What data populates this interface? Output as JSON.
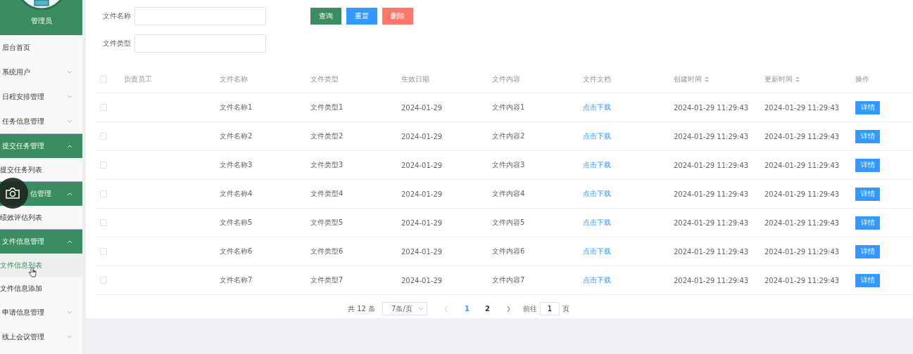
{
  "sidebar": {
    "user": "管理员",
    "items": [
      {
        "kind": "item",
        "label": "后台首页"
      },
      {
        "kind": "group",
        "label": "系统用户",
        "expanded": false
      },
      {
        "kind": "group",
        "label": "日程安排管理",
        "expanded": false
      },
      {
        "kind": "group",
        "label": "任务信息管理",
        "expanded": false
      },
      {
        "kind": "group",
        "label": "提交任务管理",
        "expanded": true,
        "children": [
          {
            "label": "提交任务列表",
            "selected": false
          }
        ]
      },
      {
        "kind": "group",
        "label": "估管理",
        "expanded": true,
        "covered": true,
        "children": [
          {
            "label": "绩效评估列表",
            "selected": false
          }
        ]
      },
      {
        "kind": "group",
        "label": "文件信息管理",
        "expanded": true,
        "children": [
          {
            "label": "文件信息列表",
            "selected": true
          },
          {
            "label": "文件信息添加",
            "selected": false
          }
        ]
      },
      {
        "kind": "group",
        "label": "申请信息管理",
        "expanded": false
      },
      {
        "kind": "group",
        "label": "线上会议管理",
        "expanded": false
      }
    ]
  },
  "search": {
    "fields": [
      {
        "label": "文件名称"
      },
      {
        "label": "文件类型"
      }
    ],
    "buttons": [
      {
        "label": "查询",
        "kind": "query"
      },
      {
        "label": "重置",
        "kind": "reset"
      },
      {
        "label": "删除",
        "kind": "delete"
      }
    ]
  },
  "table": {
    "all_checked": false,
    "columns": [
      {
        "label": "负责员工",
        "sortable": false
      },
      {
        "label": "文件名称",
        "sortable": false
      },
      {
        "label": "文件类型",
        "sortable": false
      },
      {
        "label": "生效日期",
        "sortable": false
      },
      {
        "label": "文件内容",
        "sortable": false
      },
      {
        "label": "文件文档",
        "sortable": false
      },
      {
        "label": "创建时间",
        "sortable": true
      },
      {
        "label": "更新时间",
        "sortable": true
      },
      {
        "label": "操作",
        "sortable": false
      }
    ],
    "rows": [
      {
        "checked": false,
        "cells": [
          "",
          "文件名称1",
          "文件类型1",
          "2024-01-29",
          "文件内容1",
          "点击下载",
          "2024-01-29 11:29:43",
          "2024-01-29 11:29:43"
        ],
        "action": "详情"
      },
      {
        "checked": false,
        "cells": [
          "",
          "文件名称2",
          "文件类型2",
          "2024-01-29",
          "文件内容2",
          "点击下载",
          "2024-01-29 11:29:43",
          "2024-01-29 11:29:43"
        ],
        "action": "详情"
      },
      {
        "checked": false,
        "cells": [
          "",
          "文件名称3",
          "文件类型3",
          "2024-01-29",
          "文件内容3",
          "点击下载",
          "2024-01-29 11:29:43",
          "2024-01-29 11:29:43"
        ],
        "action": "详情"
      },
      {
        "checked": false,
        "cells": [
          "",
          "文件名称4",
          "文件类型4",
          "2024-01-29",
          "文件内容4",
          "点击下载",
          "2024-01-29 11:29:43",
          "2024-01-29 11:29:43"
        ],
        "action": "详情"
      },
      {
        "checked": false,
        "cells": [
          "",
          "文件名称5",
          "文件类型5",
          "2024-01-29",
          "文件内容5",
          "点击下载",
          "2024-01-29 11:29:43",
          "2024-01-29 11:29:43"
        ],
        "action": "详情"
      },
      {
        "checked": false,
        "cells": [
          "",
          "文件名称6",
          "文件类型6",
          "2024-01-29",
          "文件内容6",
          "点击下载",
          "2024-01-29 11:29:43",
          "2024-01-29 11:29:43"
        ],
        "action": "详情"
      },
      {
        "checked": false,
        "cells": [
          "",
          "文件名称7",
          "文件类型7",
          "2024-01-29",
          "文件内容7",
          "点击下载",
          "2024-01-29 11:29:43",
          "2024-01-29 11:29:43"
        ],
        "action": "详情"
      }
    ]
  },
  "pagination": {
    "total": "共 12 条",
    "page_size": "7条/页",
    "pages": [
      {
        "label": "1",
        "selected": true
      },
      {
        "label": "2",
        "selected": false
      }
    ],
    "goto_label": "前往",
    "goto_value": "1",
    "page_suffix": "页"
  }
}
